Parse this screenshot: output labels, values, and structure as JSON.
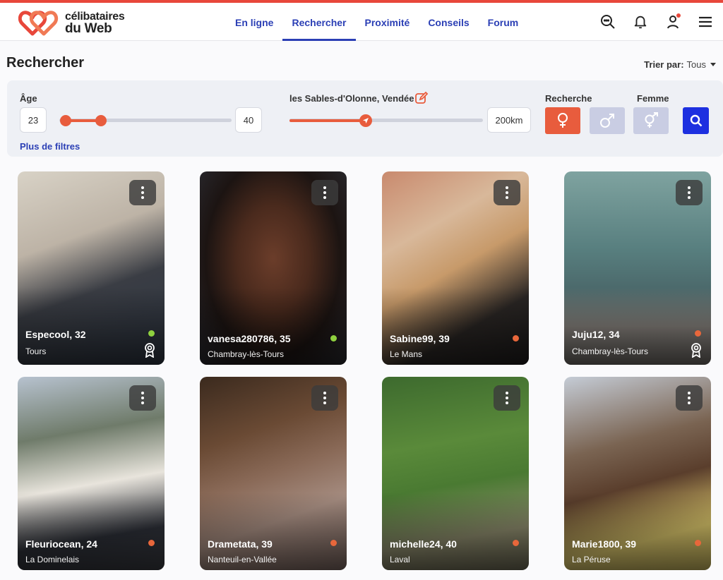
{
  "brand": {
    "line1": "célibataires",
    "line2": "du Web"
  },
  "nav": {
    "items": [
      {
        "label": "En ligne"
      },
      {
        "label": "Rechercher"
      },
      {
        "label": "Proximité"
      },
      {
        "label": "Conseils"
      },
      {
        "label": "Forum"
      }
    ],
    "active_index": 1
  },
  "page": {
    "title": "Rechercher",
    "sort_label": "Trier par:",
    "sort_value": "Tous"
  },
  "filters": {
    "age_label": "Âge",
    "age_min": "23",
    "age_max": "40",
    "location": "les Sables-d'Olonne, Vendée",
    "radius": "200km",
    "seeking_label": "Recherche",
    "gender_label": "Femme",
    "more_filters": "Plus de filtres"
  },
  "colors": {
    "accent": "#e85c3d",
    "brand_blue": "#2b3fb5",
    "search_blue": "#1d30e0",
    "online": "#8fd13f",
    "away": "#e8673b"
  },
  "profiles": [
    {
      "name": "Especool, 32",
      "city": "Tours",
      "status": "online",
      "badge": true
    },
    {
      "name": "vanesa280786, 35",
      "city": "Chambray-lès-Tours",
      "status": "online",
      "badge": false
    },
    {
      "name": "Sabine99, 39",
      "city": "Le Mans",
      "status": "away",
      "badge": false
    },
    {
      "name": "Juju12, 34",
      "city": "Chambray-lès-Tours",
      "status": "away",
      "badge": true
    },
    {
      "name": "Fleuriocean, 24",
      "city": "La Dominelais",
      "status": "away",
      "badge": false
    },
    {
      "name": "Drametata, 39",
      "city": "Nanteuil-en-Vallée",
      "status": "away",
      "badge": false
    },
    {
      "name": "michelle24, 40",
      "city": "Laval",
      "status": "away",
      "badge": false
    },
    {
      "name": "Marie1800, 39",
      "city": "La Péruse",
      "status": "away",
      "badge": false
    }
  ]
}
